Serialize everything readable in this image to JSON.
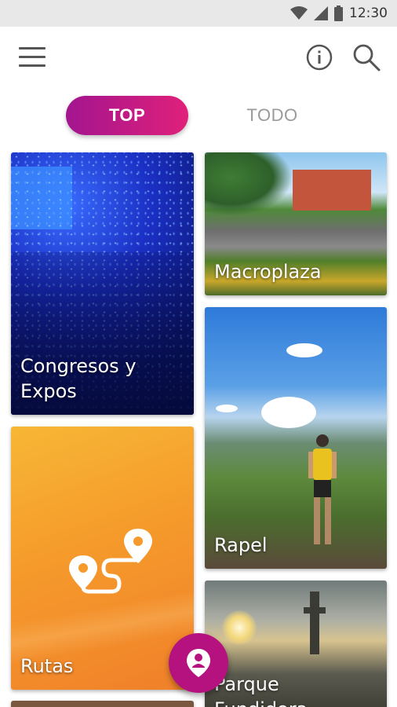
{
  "status_bar": {
    "time": "12:30"
  },
  "tabs": [
    {
      "label": "TOP",
      "active": true
    },
    {
      "label": "TODO",
      "active": false
    }
  ],
  "cards": {
    "congresos": {
      "label_line1": "Congresos y",
      "label_line2": "Expos"
    },
    "macroplaza": {
      "label": "Macroplaza"
    },
    "rapel": {
      "label": "Rapel"
    },
    "rutas": {
      "label": "Rutas"
    },
    "fundidora": {
      "label_line1": "Parque",
      "label_line2": "Fundidora"
    }
  },
  "colors": {
    "accent": "#b5127f",
    "tab_gradient_start": "#a3158f",
    "tab_gradient_end": "#e0207a"
  },
  "icons": [
    "wifi-icon",
    "signal-icon",
    "battery-icon",
    "menu-icon",
    "info-icon",
    "search-icon",
    "route-icon",
    "location-pin-icon"
  ]
}
